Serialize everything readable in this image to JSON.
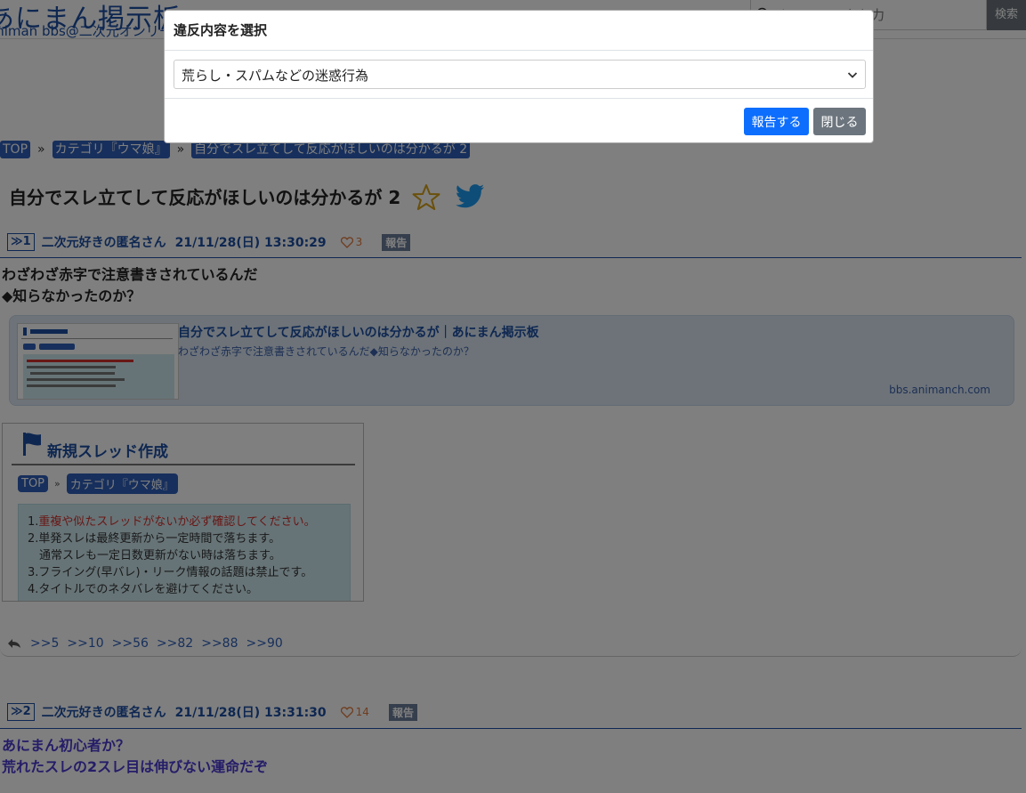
{
  "header": {
    "logo_title": "あにまん掲示板",
    "logo_sub": "animan bbs@二次元オンリー",
    "search_placeholder": "キーワードを入力",
    "search_button": "検索"
  },
  "breadcrumb": {
    "items": [
      "TOP",
      "カテゴリ『ウマ娘』",
      "自分でスレ立てして反応がほしいのは分かるが 2"
    ],
    "separator": "»"
  },
  "thread": {
    "title": "自分でスレ立てして反応がほしいのは分かるが 2"
  },
  "posts": [
    {
      "number": "≫1",
      "name": "二次元好きの匿名さん",
      "date": "21/11/28(日) 13:30:29",
      "likes": "3",
      "report": "報告",
      "lines": [
        "わざわざ赤字で注意書きされているんだ",
        "◆知らなかったのか？"
      ],
      "link_card": {
        "title": "自分でスレ立てして反応がほしいのは分かるが｜あにまん掲示板",
        "description": "わざわざ赤字で注意書きされているんだ◆知らなかったのか？",
        "domain": "bbs.animanch.com"
      },
      "embed": {
        "title": "新規スレッド作成",
        "crumbs": [
          "TOP",
          "カテゴリ『ウマ娘』"
        ],
        "crumb_sep": "»",
        "notice": [
          {
            "prefix": "1.",
            "text": "重複や似たスレッドがないか必ず確認してください。"
          },
          {
            "prefix": "",
            "text": "2.単発スレは最終更新から一定時間で落ちます。"
          },
          {
            "prefix": "",
            "text": "　通常スレも一定日数更新がない時は落ちます。"
          },
          {
            "prefix": "",
            "text": "3.フライング(早バレ)・リーク情報の話題は禁止です。"
          },
          {
            "prefix": "",
            "text": "4.タイトルでのネタバレを避けてください。"
          }
        ]
      },
      "replies": [
        ">>5",
        ">>10",
        ">>56",
        ">>82",
        ">>88",
        ">>90"
      ]
    },
    {
      "number": "≫2",
      "name": "二次元好きの匿名さん",
      "date": "21/11/28(日) 13:31:30",
      "likes": "14",
      "report": "報告",
      "lines": [
        "あにまん初心者か？",
        "荒れたスレの2スレ目は伸びない運命だぞ"
      ]
    }
  ],
  "modal": {
    "title": "違反内容を選択",
    "selected_option": "荒らし・スパムなどの迷惑行為",
    "submit_label": "報告する",
    "close_label": "閉じる"
  },
  "colors": {
    "accent": "#1d4fa3",
    "primary_button": "#0d6efd",
    "secondary_button": "#6c757d",
    "like": "#e07a3f"
  }
}
